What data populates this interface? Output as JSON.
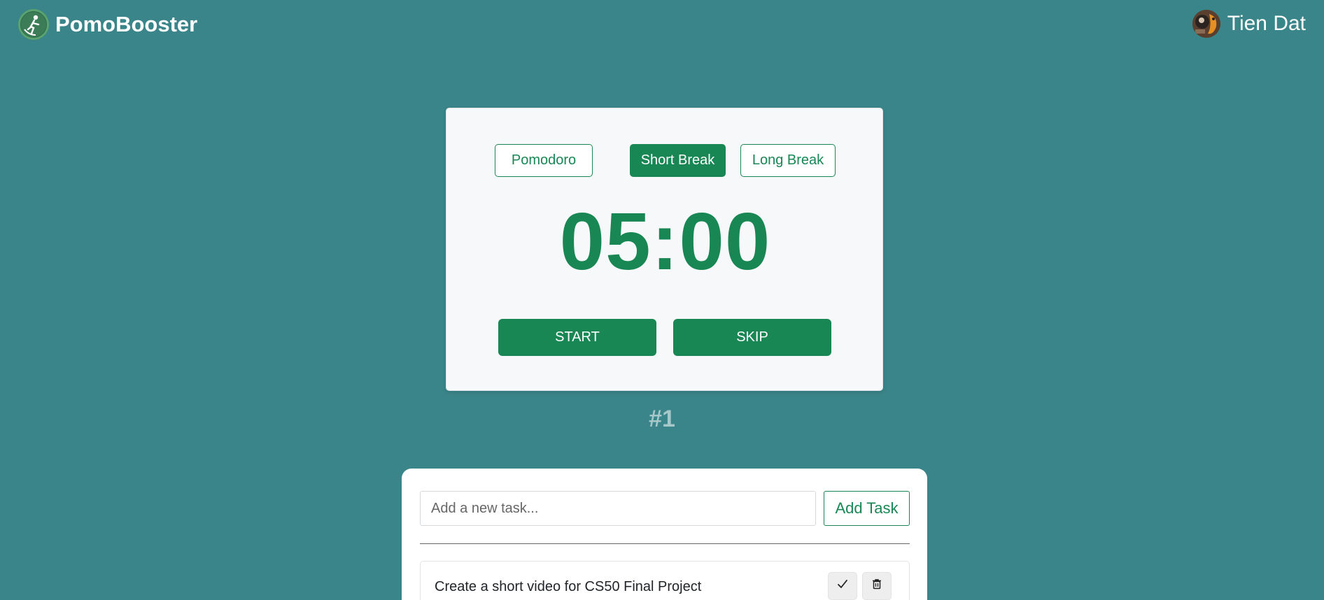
{
  "header": {
    "brand_name": "PomoBooster",
    "user_name": "Tien Dat"
  },
  "timer": {
    "modes": [
      {
        "label": "Pomodoro",
        "active": false
      },
      {
        "label": "Short Break",
        "active": true
      },
      {
        "label": "Long Break",
        "active": false
      }
    ],
    "time": "05:00",
    "start_label": "START",
    "skip_label": "SKIP",
    "session": "#1"
  },
  "tasks": {
    "input_placeholder": "Add a new task...",
    "input_value": "",
    "add_label": "Add Task",
    "items": [
      {
        "text": "Create a short video for CS50 Final Project"
      }
    ]
  },
  "colors": {
    "background": "#3a8589",
    "accent": "#198754",
    "card": "#f6f8fa"
  },
  "icons": {
    "logo": "pomobooster-logo-icon",
    "avatar": "user-avatar",
    "done": "checkmark-icon",
    "delete": "trash-icon"
  }
}
